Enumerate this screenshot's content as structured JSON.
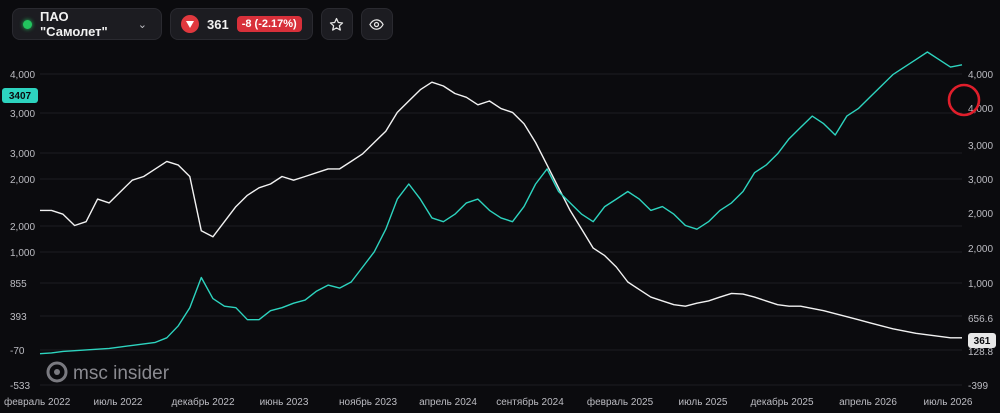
{
  "header": {
    "ticker": "ПАО \"Самолет\"",
    "price": "361",
    "change": "-8 (-2.17%)",
    "status_color": "#22c55e"
  },
  "logo": {
    "text": "msc insider"
  },
  "icons": [
    "chevron-down-icon",
    "down-arrow-icon",
    "star-icon",
    "eye-icon"
  ],
  "chart_data": {
    "type": "line",
    "x_ticks": [
      "февраль 2022",
      "июль 2022",
      "декабрь 2022",
      "июнь 2023",
      "ноябрь 2023",
      "апрель 2024",
      "сентябрь 2024",
      "февраль 2025",
      "июль 2025",
      "декабрь 2025",
      "апрель 2026",
      "июль 2026"
    ],
    "left_axis": {
      "ticks": [
        "4,000",
        "3,000",
        "3,000",
        "2,000",
        "2,000",
        "1,000",
        "855",
        "393",
        "-70",
        "-533"
      ],
      "badge": "3407",
      "badge_color": "#2dd4bf"
    },
    "right_axis": {
      "ticks": [
        "4,000",
        "4,000",
        "3,000",
        "3,000",
        "2,000",
        "2,000",
        "1,000",
        "656.6",
        "128.8",
        "-399"
      ],
      "badge": "361",
      "badge_color": "#e8e8e8"
    },
    "series": [
      {
        "color": "#f2f2f2",
        "axis": "left",
        "values": [
          2050,
          2050,
          2000,
          1850,
          1900,
          2200,
          2150,
          2300,
          2450,
          2500,
          2600,
          2700,
          2650,
          2500,
          1780,
          1700,
          1900,
          2100,
          2250,
          2350,
          2400,
          2500,
          2450,
          2500,
          2550,
          2600,
          2600,
          2700,
          2800,
          2950,
          3100,
          3350,
          3500,
          3650,
          3750,
          3700,
          3600,
          3550,
          3450,
          3500,
          3400,
          3350,
          3200,
          2950,
          2650,
          2350,
          2050,
          1800,
          1550,
          1450,
          1300,
          1100,
          1000,
          900,
          850,
          800,
          780,
          820,
          850,
          900,
          950,
          940,
          900,
          850,
          800,
          780,
          780,
          750,
          720,
          680,
          640,
          600,
          560,
          520,
          480,
          450,
          420,
          400,
          380,
          360,
          361
        ]
      },
      {
        "color": "#2dd4bf",
        "axis": "right",
        "values": [
          150,
          160,
          180,
          190,
          200,
          210,
          220,
          240,
          260,
          280,
          300,
          360,
          520,
          760,
          1160,
          880,
          780,
          760,
          600,
          600,
          720,
          760,
          820,
          860,
          980,
          1060,
          1020,
          1100,
          1300,
          1500,
          1800,
          2200,
          2400,
          2200,
          1950,
          1900,
          2000,
          2150,
          2200,
          2050,
          1950,
          1900,
          2100,
          2400,
          2600,
          2300,
          2150,
          2000,
          1900,
          2100,
          2200,
          2300,
          2200,
          2050,
          2100,
          2000,
          1850,
          1800,
          1900,
          2050,
          2150,
          2300,
          2550,
          2650,
          2800,
          3000,
          3150,
          3300,
          3200,
          3050,
          3300,
          3400,
          3550,
          3700,
          3850,
          3950,
          4050,
          4150,
          4050,
          3950,
          3980
        ]
      }
    ],
    "grid": true,
    "annotation": "red circle around the latest peak"
  }
}
